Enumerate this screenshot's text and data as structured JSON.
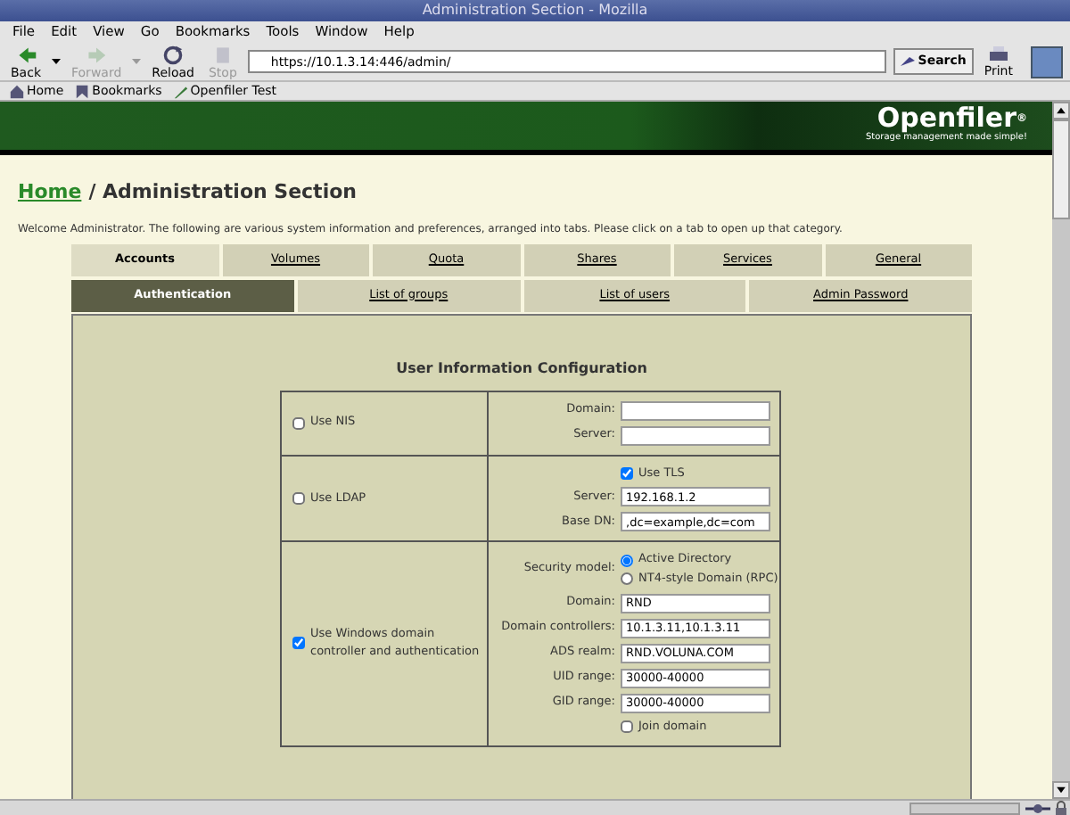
{
  "window": {
    "title": "Administration Section - Mozilla"
  },
  "menu": [
    "File",
    "Edit",
    "View",
    "Go",
    "Bookmarks",
    "Tools",
    "Window",
    "Help"
  ],
  "toolbar": [
    {
      "label": "Back",
      "kind": "back",
      "disabled": false,
      "dropdown": true
    },
    {
      "label": "Forward",
      "kind": "forward",
      "disabled": true,
      "dropdown": true
    },
    {
      "label": "Reload",
      "kind": "reload",
      "disabled": false,
      "dropdown": false
    },
    {
      "label": "Stop",
      "kind": "stop",
      "disabled": true,
      "dropdown": false
    }
  ],
  "address": {
    "value": "https://10.1.3.14:446/admin/"
  },
  "search_button": "Search",
  "print_button": "Print",
  "bookmarks": [
    {
      "label": "Home",
      "kind": "home"
    },
    {
      "label": "Bookmarks",
      "kind": "bookmarks"
    },
    {
      "label": "Openfiler Test",
      "kind": "page"
    }
  ],
  "banner": {
    "logo": "Openfiler",
    "mark": "®",
    "tagline": "Storage management made simple!"
  },
  "breadcrumb": {
    "link": "Home",
    "title": "/ Administration Section"
  },
  "welcome": "Welcome Administrator. The following are various system information and preferences, arranged into tabs. Please click on a tab to open up that category.",
  "tabs": [
    {
      "label": "Accounts",
      "selected": true
    },
    {
      "label": "Volumes",
      "selected": false
    },
    {
      "label": "Quota",
      "selected": false
    },
    {
      "label": "Shares",
      "selected": false
    },
    {
      "label": "Services",
      "selected": false
    },
    {
      "label": "General",
      "selected": false
    }
  ],
  "subtabs": [
    {
      "label": "Authentication",
      "selected": true
    },
    {
      "label": "List of groups",
      "selected": false
    },
    {
      "label": "List of users",
      "selected": false
    },
    {
      "label": "Admin Password",
      "selected": false
    }
  ],
  "section_title": "User Information Configuration",
  "auth_rows": [
    {
      "option": {
        "label": "Use NIS",
        "checked": false
      },
      "items": [
        {
          "kind": "field",
          "label": "Domain:",
          "value": ""
        },
        {
          "kind": "field",
          "label": "Server:",
          "value": ""
        }
      ]
    },
    {
      "option": {
        "label": "Use LDAP",
        "checked": false
      },
      "items": [
        {
          "kind": "checkbox",
          "label": "Use TLS",
          "checked": true
        },
        {
          "kind": "field",
          "label": "Server:",
          "value": "192.168.1.2"
        },
        {
          "kind": "field",
          "label": "Base DN:",
          "value": ",dc=example,dc=com"
        }
      ]
    },
    {
      "option": {
        "label": "Use Windows domain controller and authentication",
        "checked": true
      },
      "items": [
        {
          "kind": "radio_group",
          "label": "Security model:",
          "options": [
            {
              "label": "Active Directory",
              "selected": true
            },
            {
              "label": "NT4-style Domain (RPC)",
              "selected": false
            }
          ]
        },
        {
          "kind": "field",
          "label": "Domain:",
          "value": "RND"
        },
        {
          "kind": "field",
          "label": "Domain controllers:",
          "value": "10.1.3.11,10.1.3.11"
        },
        {
          "kind": "field",
          "label": "ADS realm:",
          "value": "RND.VOLUNA.COM"
        },
        {
          "kind": "field",
          "label": "UID range:",
          "value": "30000-40000"
        },
        {
          "kind": "field",
          "label": "GID range:",
          "value": "30000-40000"
        },
        {
          "kind": "checkbox",
          "label": "Join domain",
          "checked": false
        }
      ]
    }
  ]
}
